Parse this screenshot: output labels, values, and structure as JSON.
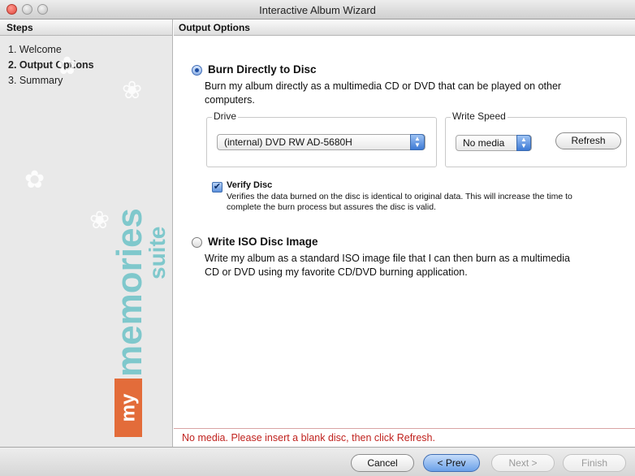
{
  "window": {
    "title": "Interactive Album Wizard"
  },
  "sidebar": {
    "header": "Steps",
    "steps": [
      {
        "label": "1. Welcome",
        "active": false
      },
      {
        "label": "2. Output Options",
        "active": true
      },
      {
        "label": "3. Summary",
        "active": false
      }
    ],
    "brand": {
      "my": "my",
      "memories": "memories",
      "suite": "suite"
    }
  },
  "main": {
    "header": "Output Options",
    "burn": {
      "title": "Burn Directly to Disc",
      "selected": true,
      "description_line1": "Burn my album directly as a multimedia CD or DVD that can be played on other",
      "description_line2": "computers."
    },
    "drive": {
      "label": "Drive",
      "value": "(internal) DVD RW AD-5680H"
    },
    "write_speed": {
      "label": "Write Speed",
      "value": "No media",
      "refresh_label": "Refresh"
    },
    "verify": {
      "checked": true,
      "title": "Verify Disc",
      "description_line1": "Verifies the data burned on the disc is identical to original data. This will increase the time to",
      "description_line2": "complete the burn process but assures the disc is valid."
    },
    "iso": {
      "title": "Write ISO Disc Image",
      "selected": false,
      "description_line1": "Write my album as a standard ISO image file that I can then burn as a multimedia",
      "description_line2": "CD or DVD using my favorite CD/DVD burning application."
    },
    "status": "No media. Please insert a blank disc, then click Refresh."
  },
  "footer": {
    "cancel": "Cancel",
    "prev": "< Prev",
    "next": "Next >",
    "finish": "Finish"
  },
  "colors": {
    "status_red": "#c0221e",
    "brand_teal": "#7fc8cc",
    "brand_orange": "#e36c3a",
    "accent_blue": "#3d7ad5"
  }
}
